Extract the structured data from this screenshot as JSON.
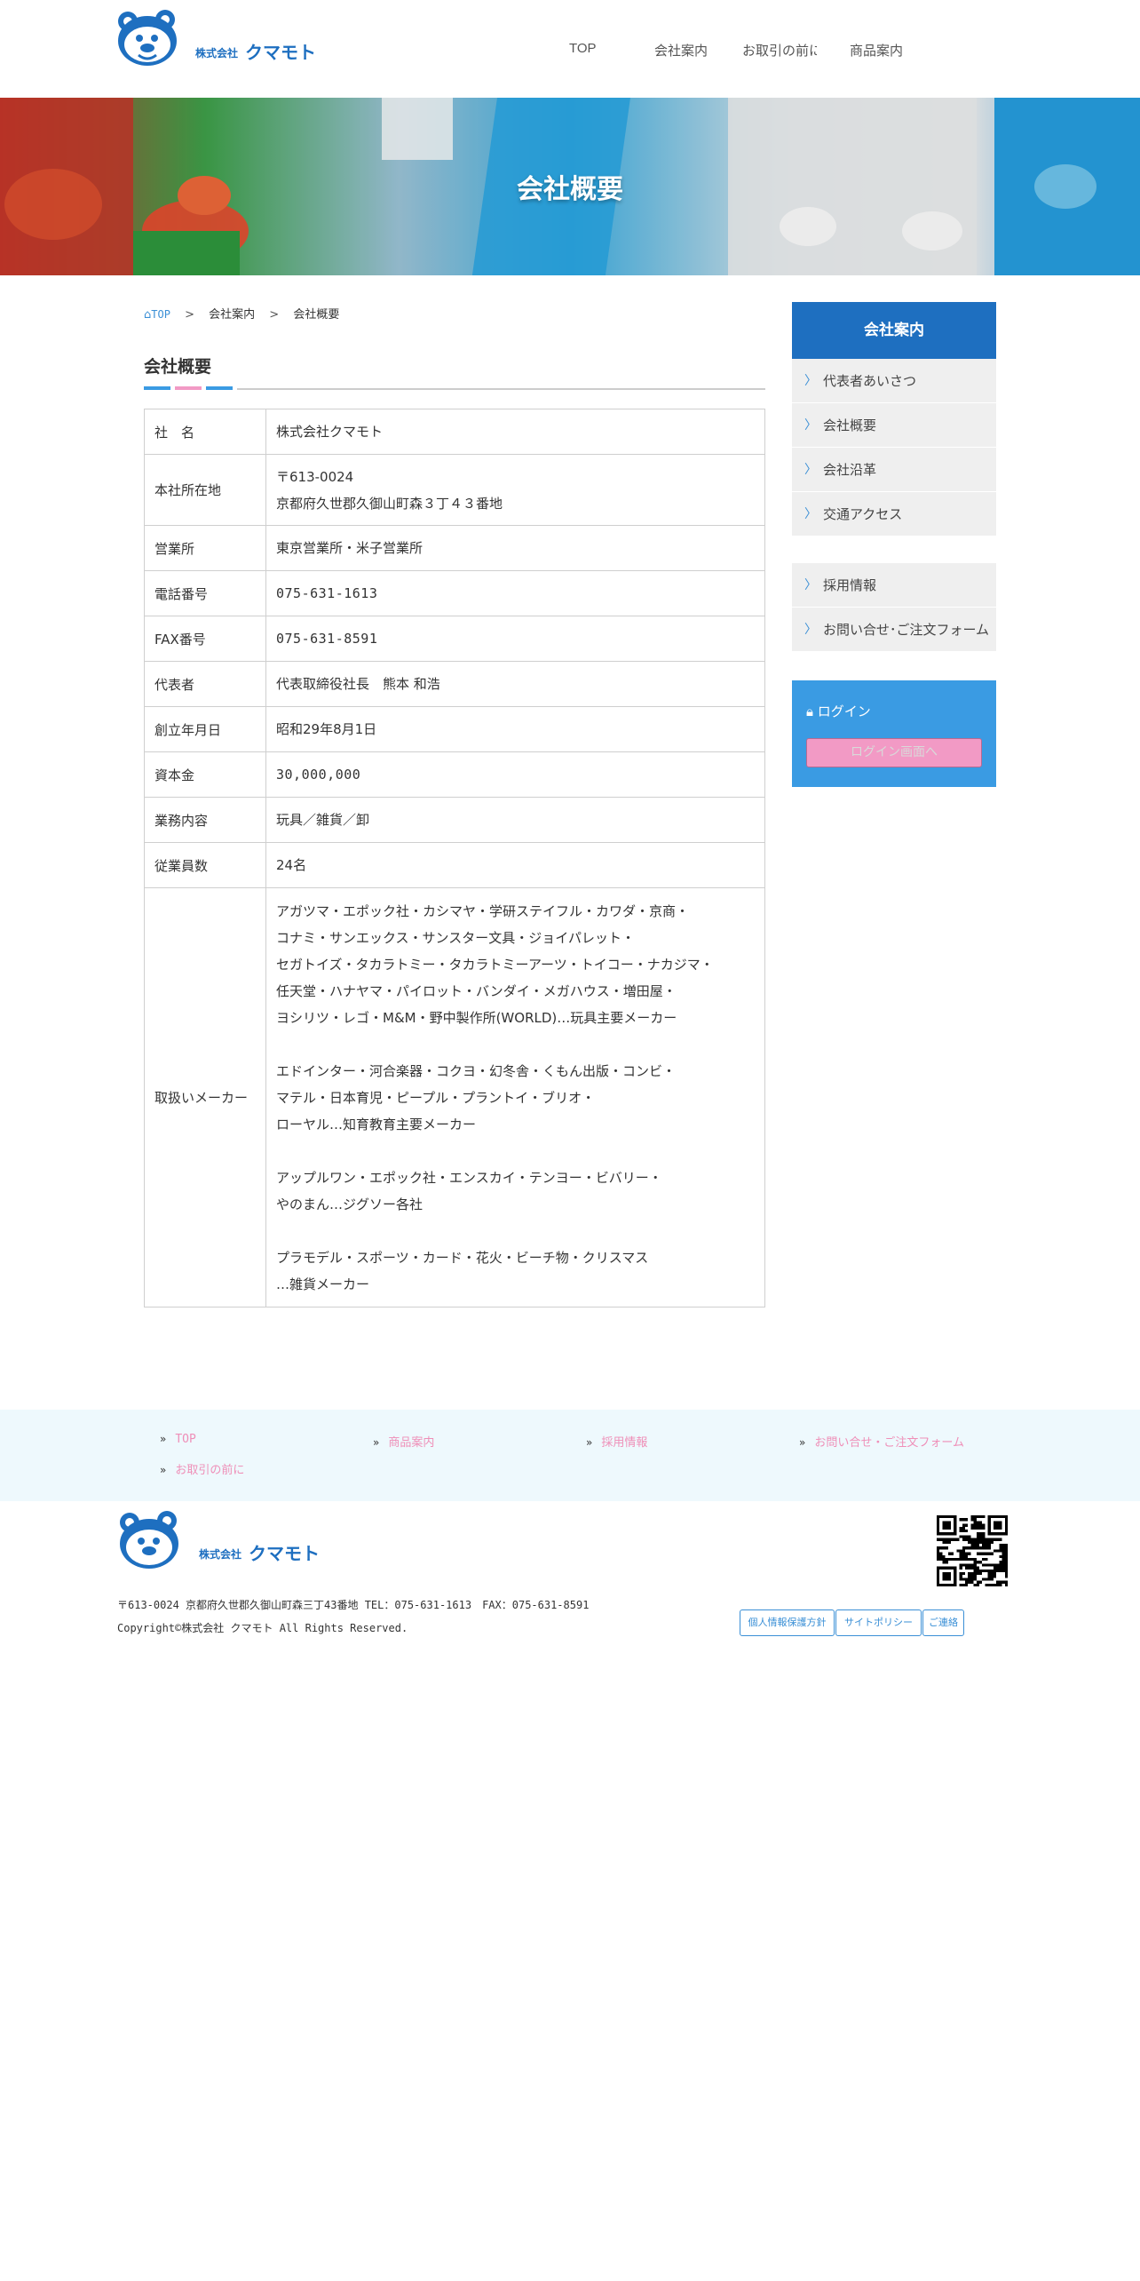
{
  "header": {
    "logo_kana": "クマモト",
    "logo_prefix": "株式会社",
    "nav": [
      "TOP",
      "会社案内",
      "お取引の前に",
      "商品案内"
    ]
  },
  "hero": {
    "title": "会社概要"
  },
  "breadcrumb": {
    "home": "TOP",
    "sep": ">",
    "items": [
      "会社案内",
      "会社概要"
    ]
  },
  "section": {
    "title": "会社概要"
  },
  "company_table": [
    {
      "label": "社　名",
      "lines": [
        "株式会社クマモト"
      ]
    },
    {
      "label": "本社所在地",
      "lines": [
        "〒613-0024",
        "京都府久世郡久御山町森３丁４３番地"
      ]
    },
    {
      "label": "営業所",
      "lines": [
        "東京営業所・米子営業所"
      ]
    },
    {
      "label": "電話番号",
      "lines": [
        "075-631-1613"
      ]
    },
    {
      "label": "FAX番号",
      "lines": [
        "075-631-8591"
      ]
    },
    {
      "label": "代表者",
      "lines": [
        "代表取締役社長　熊本 和浩"
      ]
    },
    {
      "label": "創立年月日",
      "lines": [
        "昭和29年8月1日"
      ]
    },
    {
      "label": "資本金",
      "lines": [
        "30,000,000"
      ]
    },
    {
      "label": "業務内容",
      "lines": [
        "玩具／雑貨／卸"
      ]
    },
    {
      "label": "従業員数",
      "lines": [
        "24名"
      ]
    },
    {
      "label": "取扱いメーカー",
      "lines": [
        "アガツマ・エポック社・カシマヤ・学研ステイフル・カワダ・京商・",
        "コナミ・サンエックス・サンスター文具・ジョイパレット・",
        "セガトイズ・タカラトミー・タカラトミーアーツ・トイコー・ナカジマ・",
        "任天堂・ハナヤマ・パイロット・バンダイ・メガハウス・増田屋・",
        "ヨシリツ・レゴ・M&M・野中製作所(WORLD)…玩具主要メーカー",
        "",
        "エドインター・河合楽器・コクヨ・幻冬舎・くもん出版・コンビ・",
        "マテル・日本育児・ピープル・プラントイ・ブリオ・",
        "ローヤル…知育教育主要メーカー",
        "",
        "アップルワン・エポック社・エンスカイ・テンヨー・ビバリー・",
        "やのまん…ジグソー各社",
        "",
        "プラモデル・スポーツ・カード・花火・ビーチ物・クリスマス",
        "…雑貨メーカー"
      ]
    }
  ],
  "sidebar": {
    "title": "会社案内",
    "group1": [
      "代表者あいさつ",
      "会社概要",
      "会社沿革",
      "交通アクセス"
    ],
    "group2": [
      "採用情報",
      "お問い合せ･ご注文フォーム"
    ],
    "login_label": "ログイン",
    "login_button": "ログイン画面へ"
  },
  "footer_nav": [
    "TOP",
    "商品案内",
    "採用情報",
    "お問い合せ・ご注文フォーム",
    "お取引の前に"
  ],
  "footer": {
    "address": "〒613-0024 京都府久世郡久御山町森三丁43番地 TEL：075-631-1613　FAX：075-631-8591",
    "copyright": "Copyright©株式会社 クマモト All Rights Reserved.",
    "buttons": [
      "個人情報保護方針",
      "サイトポリシー",
      "ご連絡"
    ]
  },
  "colors": {
    "brand_blue": "#1e6fc0",
    "accent_blue": "#3a9be3",
    "pink": "#f29ac5",
    "footer_bg": "#eef9fd"
  }
}
